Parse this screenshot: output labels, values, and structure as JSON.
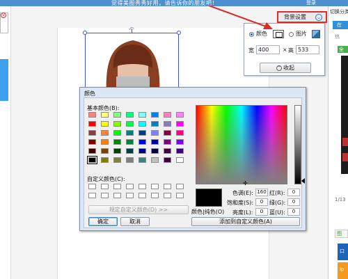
{
  "banner": {
    "text": "觉得美图秀秀好用，请告诉你的朋友吧！",
    "right_text": "登录"
  },
  "left_panel": {
    "close_glyph": "×"
  },
  "right_panel": {
    "label": "切换分类",
    "tab": "在",
    "hot": "热",
    "green": "全部",
    "page": "1/13",
    "box1": "图",
    "box2": "口",
    "box3": "ip"
  },
  "background_settings": {
    "button_label": "背景设置",
    "toggle_icon": "chevron-down-circle-icon",
    "popover": {
      "color_label": "颜色",
      "picture_label": "图片",
      "width_label": "宽",
      "width_value": "400",
      "times": "×",
      "height_label": "高",
      "height_value": "533",
      "collapse_label": "收起",
      "selected": "color"
    }
  },
  "color_dialog": {
    "title": "颜色",
    "basic_colors_label": "基本颜色(B):",
    "custom_colors_label": "自定义颜色(C):",
    "define_custom_button": "规定自定义颜色(D) >>",
    "ok_button": "确定",
    "cancel_button": "取消",
    "color_solid_label": "颜色|纯色(O)",
    "add_custom_button": "添加到自定义颜色(A)",
    "fields": {
      "hue_label": "色调(E):",
      "hue_value": "160",
      "sat_label": "饱和度(S):",
      "sat_value": "0",
      "lum_label": "亮度(L):",
      "lum_value": "0",
      "red_label": "红(R):",
      "red_value": "0",
      "green_label": "绿(G):",
      "green_value": "0",
      "blue_label": "蓝(U):",
      "blue_value": "0"
    },
    "basic_colors": [
      [
        "#ff8080",
        "#ffff80",
        "#80ff80",
        "#00ff80",
        "#80ffff",
        "#0080ff",
        "#ff80c0",
        "#ff80ff"
      ],
      [
        "#ff0000",
        "#ffff00",
        "#80ff00",
        "#00ff40",
        "#00ffff",
        "#0080c0",
        "#8080c0",
        "#ff00ff"
      ],
      [
        "#804040",
        "#ff8040",
        "#00ff00",
        "#008080",
        "#004080",
        "#8080ff",
        "#800040",
        "#ff0080"
      ],
      [
        "#800000",
        "#ff8000",
        "#008000",
        "#008040",
        "#0000ff",
        "#0000a0",
        "#800080",
        "#8000ff"
      ],
      [
        "#400000",
        "#804000",
        "#004000",
        "#004040",
        "#000080",
        "#000040",
        "#400040",
        "#400080"
      ],
      [
        "#000000",
        "#808000",
        "#808040",
        "#808080",
        "#408080",
        "#c0c0c0",
        "#400040",
        "#ffffff"
      ]
    ],
    "selected_basic_color": "#000000",
    "current_color": "#000000"
  },
  "colors": {
    "accent": "#2f8fd8",
    "highlight": "#e02b2b",
    "selection": "#3a56d6"
  }
}
